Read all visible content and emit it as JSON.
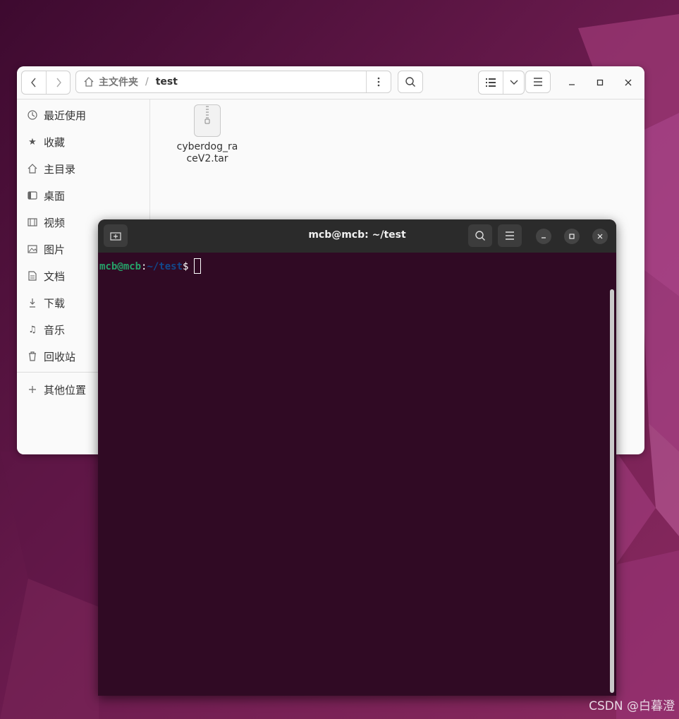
{
  "file_manager": {
    "path": {
      "home_label": "主文件夹",
      "separator": "/",
      "current": "test"
    },
    "sidebar": {
      "items": [
        {
          "label": "最近使用",
          "icon": "clock-icon"
        },
        {
          "label": "收藏",
          "icon": "star-icon"
        },
        {
          "label": "主目录",
          "icon": "home-icon"
        },
        {
          "label": "桌面",
          "icon": "desktop-icon"
        },
        {
          "label": "视频",
          "icon": "film-icon"
        },
        {
          "label": "图片",
          "icon": "image-icon"
        },
        {
          "label": "文档",
          "icon": "document-icon"
        },
        {
          "label": "下载",
          "icon": "download-icon"
        },
        {
          "label": "音乐",
          "icon": "music-icon"
        },
        {
          "label": "回收站",
          "icon": "trash-icon"
        }
      ],
      "other_locations": "其他位置"
    },
    "files": [
      {
        "name": "cyberdog_raceV2.tar",
        "icon": "archive-icon"
      }
    ]
  },
  "terminal": {
    "title": "mcb@mcb: ~/test",
    "prompt": {
      "user_host": "mcb@mcb",
      "colon": ":",
      "path": "~/test",
      "dollar": "$"
    }
  },
  "watermark": "CSDN @白暮澄",
  "colors": {
    "terminal_bg": "#300a24",
    "prompt_user": "#26a269",
    "prompt_path": "#12488b"
  }
}
